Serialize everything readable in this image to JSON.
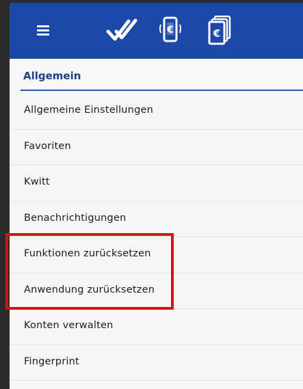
{
  "header": {
    "icons": [
      "menu-icon",
      "checkmark-logo-icon",
      "mobile-euro-icon",
      "euro-cards-icon"
    ],
    "color": "#1c49a8"
  },
  "section": {
    "title": "Allgemein"
  },
  "menu": {
    "items": [
      {
        "label": "Allgemeine Einstellungen"
      },
      {
        "label": "Favoriten"
      },
      {
        "label": "Kwitt"
      },
      {
        "label": "Benachrichtigungen"
      },
      {
        "label": "Funktionen zurücksetzen"
      },
      {
        "label": "Anwendung zurücksetzen"
      },
      {
        "label": "Konten verwalten"
      },
      {
        "label": "Fingerprint"
      }
    ]
  },
  "highlight_color": "#d4101c"
}
